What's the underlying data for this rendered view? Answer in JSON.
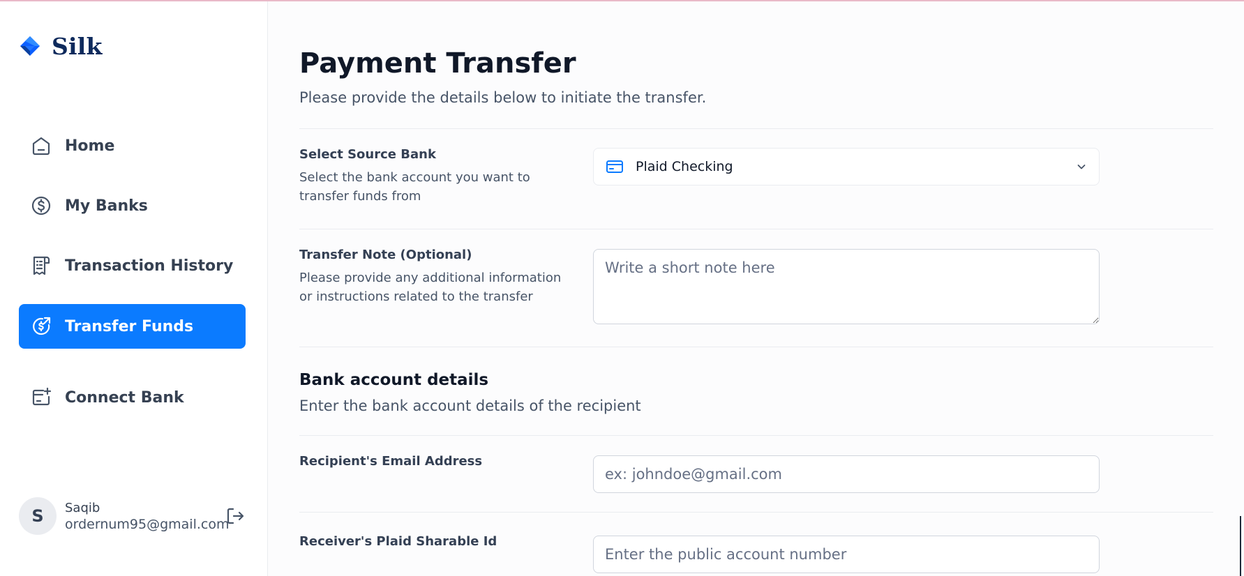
{
  "app": {
    "name": "Silk"
  },
  "sidebar": {
    "items": [
      {
        "label": "Home",
        "icon": "home-icon",
        "active": false
      },
      {
        "label": "My Banks",
        "icon": "dollar-circle-icon",
        "active": false
      },
      {
        "label": "Transaction History",
        "icon": "receipt-icon",
        "active": false
      },
      {
        "label": "Transfer Funds",
        "icon": "transfer-icon",
        "active": true
      },
      {
        "label": "Connect Bank",
        "icon": "connect-bank-icon",
        "active": false
      }
    ]
  },
  "user": {
    "initial": "S",
    "name": "Saqib",
    "email": "ordernum95@gmail.com",
    "logout_icon": "logout-icon"
  },
  "page": {
    "title": "Payment Transfer",
    "subtitle": "Please provide the details below to initiate the transfer."
  },
  "form": {
    "source_bank": {
      "label": "Select Source Bank",
      "description": "Select the bank account you want to transfer funds from",
      "value": "Plaid Checking"
    },
    "note": {
      "label": "Transfer Note (Optional)",
      "description": "Please provide any additional information or instructions related to the transfer",
      "placeholder": "Write a short note here",
      "value": ""
    },
    "bank_details": {
      "title": "Bank account details",
      "subtitle": "Enter the bank account details of the recipient"
    },
    "email": {
      "label": "Recipient's Email Address",
      "placeholder": "ex: johndoe@gmail.com",
      "value": ""
    },
    "sharable_id": {
      "label": "Receiver's Plaid Sharable Id",
      "placeholder": "Enter the public account number",
      "value": ""
    }
  },
  "colors": {
    "accent": "#0b7bff",
    "brand": "#0e2a5c",
    "text_primary": "#101828",
    "text_secondary": "#475467"
  }
}
